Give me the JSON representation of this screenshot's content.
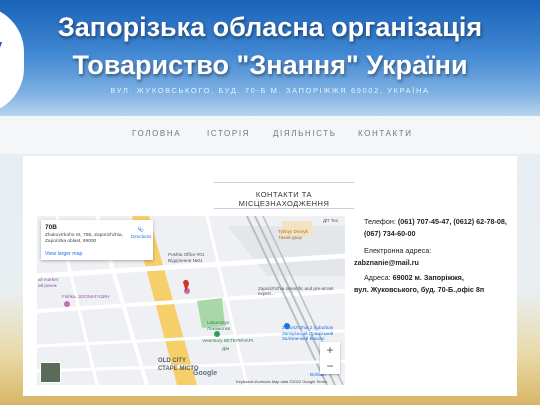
{
  "header": {
    "title_line1": "Запорізька обласна організація",
    "title_line2": "Товариство \"Знання\" України",
    "address": "ВУЛ. ЖУКОВСЬКОГО, БУД. 70-Б М. ЗАПОРІЖЖЯ 69002, УКРАЇНА"
  },
  "nav": {
    "items": [
      "ГОЛОВНА",
      "ІСТОРІЯ",
      "ДІЯЛЬНІСТЬ",
      "КОНТАКТИ"
    ]
  },
  "section": {
    "title": "КОНТАКТИ ТА МІСЦЕЗНАХОДЖЕННЯ"
  },
  "map": {
    "place_title": "70B",
    "place_address": "Zhukovs'koho St, 70Б, Zaporizhzhia, Zaporizka oblast, 69000",
    "larger_map_link": "View larger map",
    "directions_label": "Directions",
    "zoom_in": "+",
    "zoom_out": "−",
    "google_label": "Google",
    "footer": "Keyboard shortcuts   Map data ©2022 Google   Terms",
    "labels": {
      "tykhyi": "Tykhyy Dvoryk",
      "tykhyi_ua": "Тихий двор",
      "posta": "Poshta Office #01",
      "posta_ua": "Відділення №01",
      "mall": "all market",
      "mall_ua": "ий ринок",
      "fishka": "Fishka, ЗООМАГАЗИН",
      "expert": "Zaporizhzhia scientific and pre-arrant expert...",
      "lokomotyv": "Lokomotyv",
      "lokomotyv_ua": "Локомотив",
      "veterinary": "Veterinary ВЕТЕРИНАРІ",
      "dim": "Дім",
      "zaporizhzhia2": "Zaporizhzhia 2 Suburban",
      "zaporizhzhia2_ua": "Запорізький Приміський Залізничний Вокзал",
      "old_city": "OLD CITY",
      "old_city_ua": "СТАРЕ МІСТО",
      "dp_tes": "ДП Тех",
      "bohdan": "Bohdan"
    }
  },
  "contacts": {
    "phone_label": "Телефон:",
    "phone_value": "(061) 707-45-47, (0612) 62-78-08, (067) 734-60-00",
    "email_label": "Електронна адреса:",
    "email_value": "zabznanie@mail.ru",
    "address_label": "Адреса:",
    "address_value": "69002 м. Запоріжжя,",
    "address_value2": "вул. Жуковського, буд. 70-Б.,офіс 8п"
  },
  "colors": {
    "header_top": "#1b63b8",
    "header_bottom": "#b9d4ee",
    "link": "#1a73e8",
    "map_pin": "#d93025",
    "park": "#a8d8a8"
  }
}
